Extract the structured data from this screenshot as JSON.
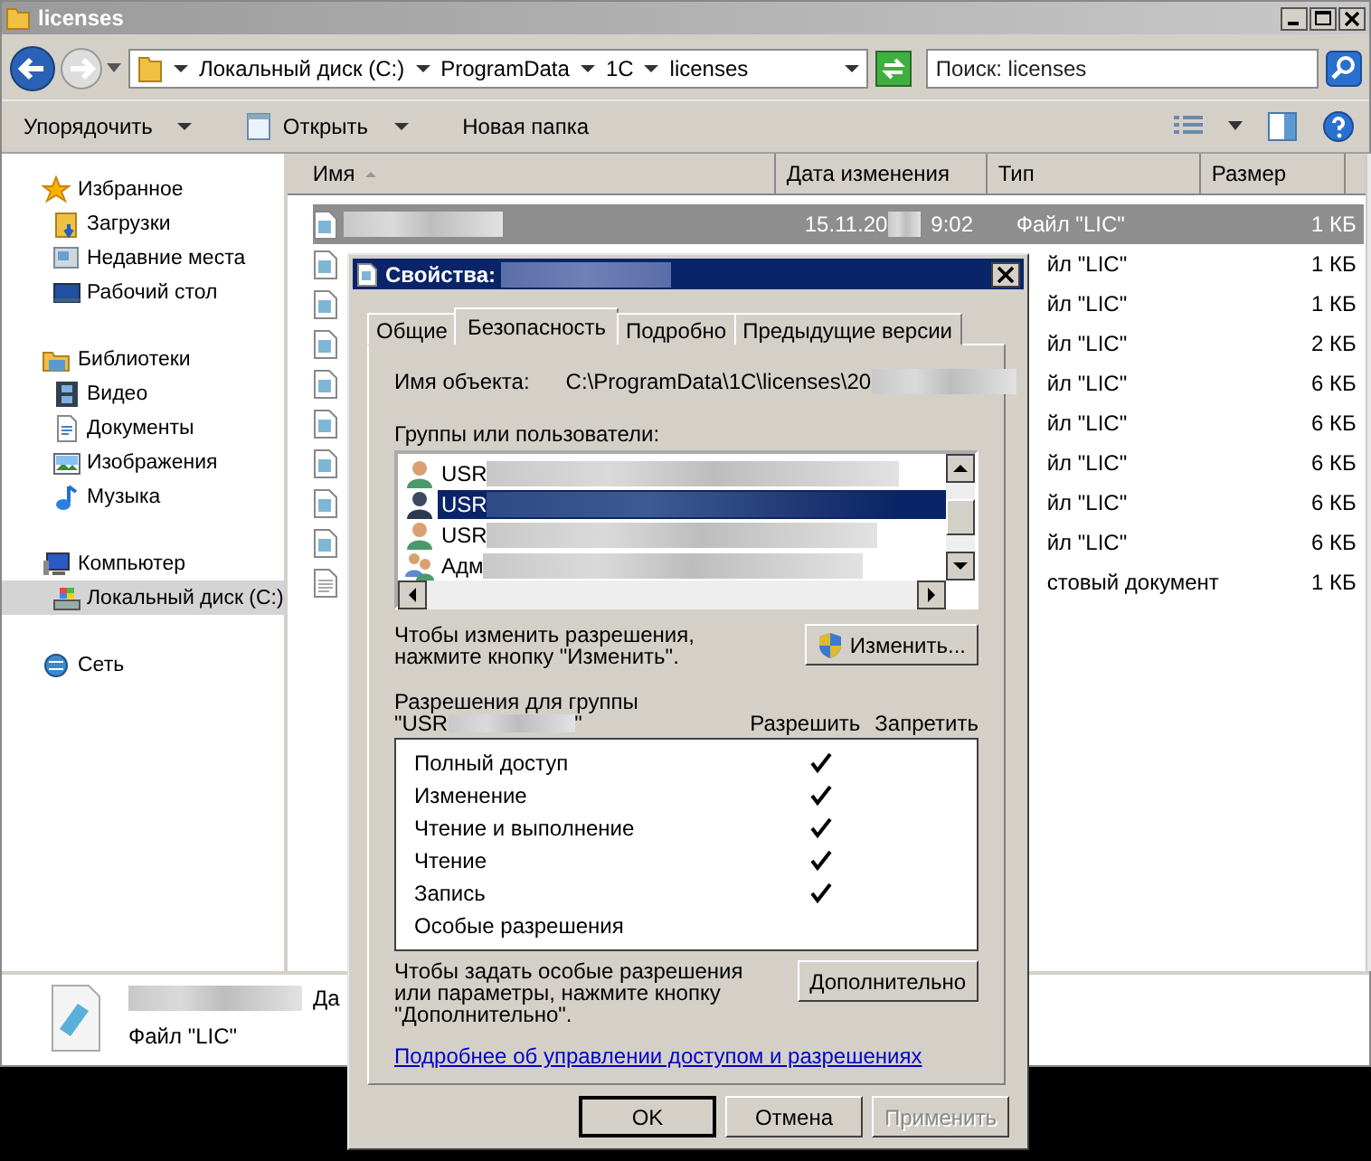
{
  "window": {
    "title": "licenses"
  },
  "address": {
    "segments": [
      "Локальный диск (C:)",
      "ProgramData",
      "1C",
      "licenses"
    ]
  },
  "search": {
    "placeholder": "Поиск: licenses"
  },
  "toolbar": [
    {
      "label": "Упорядочить",
      "kind": "menu"
    },
    {
      "label": "Открыть",
      "kind": "split"
    },
    {
      "label": "Новая папка",
      "kind": "plain"
    }
  ],
  "nav": [
    {
      "label": "Избранное",
      "kind": "star",
      "selected": false,
      "children": [
        {
          "label": "Загрузки",
          "kind": "downloads",
          "selected": false
        },
        {
          "label": "Недавние места",
          "kind": "recent",
          "selected": false
        },
        {
          "label": "Рабочий стол",
          "kind": "desktop",
          "selected": false
        }
      ]
    },
    {
      "label": "Библиотеки",
      "kind": "library",
      "selected": false,
      "children": [
        {
          "label": "Видео",
          "kind": "video",
          "selected": false
        },
        {
          "label": "Документы",
          "kind": "documents",
          "selected": false
        },
        {
          "label": "Изображения",
          "kind": "images",
          "selected": false
        },
        {
          "label": "Музыка",
          "kind": "music",
          "selected": false
        }
      ]
    },
    {
      "label": "Компьютер",
      "kind": "computer",
      "selected": false,
      "children": [
        {
          "label": "Локальный диск (C:)",
          "kind": "drive",
          "selected": true
        }
      ]
    },
    {
      "label": "Сеть",
      "kind": "network",
      "selected": false
    }
  ],
  "columns": [
    {
      "label": "Имя",
      "sorted": true
    },
    {
      "label": "Дата изменения",
      "sorted": false
    },
    {
      "label": "Тип",
      "sorted": false
    },
    {
      "label": "Размер",
      "sorted": false
    }
  ],
  "rows": [
    {
      "kind": "full",
      "selected": true,
      "date": "15.11.20",
      "time": "9:02",
      "type": "Файл \"LIC\"",
      "size": "1 КБ"
    },
    {
      "kind": "covered",
      "selected": false,
      "type": "йл \"LIC\"",
      "size": "1 КБ"
    },
    {
      "kind": "covered",
      "selected": false,
      "type": "йл \"LIC\"",
      "size": "1 КБ"
    },
    {
      "kind": "covered",
      "selected": false,
      "type": "йл \"LIC\"",
      "size": "2 КБ"
    },
    {
      "kind": "covered",
      "selected": false,
      "type": "йл \"LIC\"",
      "size": "6 КБ"
    },
    {
      "kind": "covered",
      "selected": false,
      "type": "йл \"LIC\"",
      "size": "6 КБ"
    },
    {
      "kind": "covered",
      "selected": false,
      "type": "йл \"LIC\"",
      "size": "6 КБ"
    },
    {
      "kind": "covered",
      "selected": false,
      "type": "йл \"LIC\"",
      "size": "6 КБ"
    },
    {
      "kind": "covered",
      "selected": false,
      "type": "йл \"LIC\"",
      "size": "6 КБ"
    },
    {
      "kind": "text",
      "selected": false,
      "type": "стовый документ",
      "size": "1 КБ"
    }
  ],
  "details": {
    "label": "Да",
    "type": "Файл \"LIC\""
  },
  "dialog": {
    "title": "Свойства:",
    "tabs": [
      {
        "label": "Общие",
        "selected": false
      },
      {
        "label": "Безопасность",
        "selected": true
      },
      {
        "label": "Подробно",
        "selected": false
      },
      {
        "label": "Предыдущие версии",
        "selected": false
      }
    ],
    "object_label": "Имя объекта:",
    "object_value": "C:\\ProgramData\\1C\\licenses\\20",
    "groups_label": "Группы или пользователи:",
    "users": [
      {
        "label": "USR",
        "kind": "user",
        "selected": false
      },
      {
        "label": "USR",
        "kind": "user",
        "selected": true
      },
      {
        "label": "USR",
        "kind": "user",
        "selected": false
      },
      {
        "label": "Адм",
        "kind": "group",
        "selected": false
      }
    ],
    "change_hint": "Чтобы изменить разрешения, нажмите кнопку \"Изменить\".",
    "change_button": "Изменить...",
    "perm_title": "Разрешения для группы",
    "perm_group_open": "\"USR",
    "perm_group_close": "\"",
    "allow_label": "Разрешить",
    "deny_label": "Запретить",
    "permissions": [
      {
        "label": "Полный доступ",
        "allow": true,
        "deny": false
      },
      {
        "label": "Изменение",
        "allow": true,
        "deny": false
      },
      {
        "label": "Чтение и выполнение",
        "allow": true,
        "deny": false
      },
      {
        "label": "Чтение",
        "allow": true,
        "deny": false
      },
      {
        "label": "Запись",
        "allow": true,
        "deny": false
      },
      {
        "label": "Особые разрешения",
        "allow": false,
        "deny": false
      }
    ],
    "advanced_hint": "Чтобы задать особые разрешения или параметры, нажмите кнопку \"Дополнительно\".",
    "advanced_button": "Дополнительно",
    "link": "Подробнее об управлении доступом и разрешениях",
    "buttons": [
      {
        "label": "OK",
        "disabled": false,
        "default": true
      },
      {
        "label": "Отмена",
        "disabled": false,
        "default": false
      },
      {
        "label": "Применить",
        "disabled": true,
        "default": false
      }
    ]
  }
}
